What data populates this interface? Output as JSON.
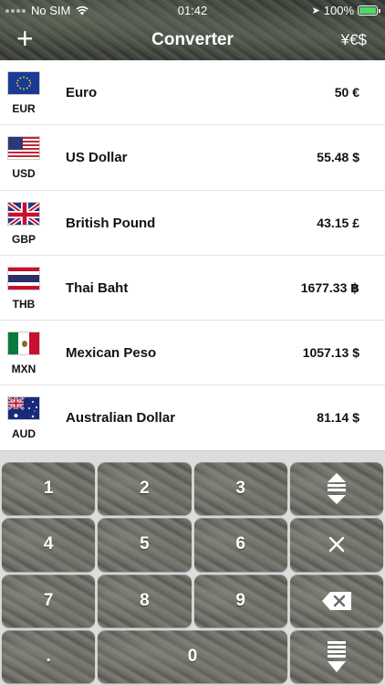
{
  "status_bar": {
    "carrier": "No SIM",
    "time": "01:42",
    "battery": "100%"
  },
  "nav": {
    "add_icon": "plus-icon",
    "title": "Converter",
    "currency_symbols": "¥€$"
  },
  "currencies": [
    {
      "code": "EUR",
      "name": "Euro",
      "amount": "50 €",
      "flag": "flag-eu-icon"
    },
    {
      "code": "USD",
      "name": "US Dollar",
      "amount": "55.48 $",
      "flag": "flag-us-icon"
    },
    {
      "code": "GBP",
      "name": "British Pound",
      "amount": "43.15 £",
      "flag": "flag-gb-icon"
    },
    {
      "code": "THB",
      "name": "Thai Baht",
      "amount": "1677.33 ฿",
      "flag": "flag-th-icon"
    },
    {
      "code": "MXN",
      "name": "Mexican Peso",
      "amount": "1057.13 $",
      "flag": "flag-mx-icon"
    },
    {
      "code": "AUD",
      "name": "Australian Dollar",
      "amount": "81.14 $",
      "flag": "flag-au-icon"
    }
  ],
  "keypad": {
    "k1": "1",
    "k2": "2",
    "k3": "3",
    "k4": "4",
    "k5": "5",
    "k6": "6",
    "k7": "7",
    "k8": "8",
    "k9": "9",
    "kdot": ".",
    "k0": "0",
    "icons": [
      "swap-arrows-icon",
      "clear-x-icon",
      "backspace-icon",
      "scroll-down-icon"
    ]
  },
  "colors": {
    "battery": "#4cd964",
    "header_bg": "#3a3d36",
    "key_bg": "#6a6c64"
  }
}
